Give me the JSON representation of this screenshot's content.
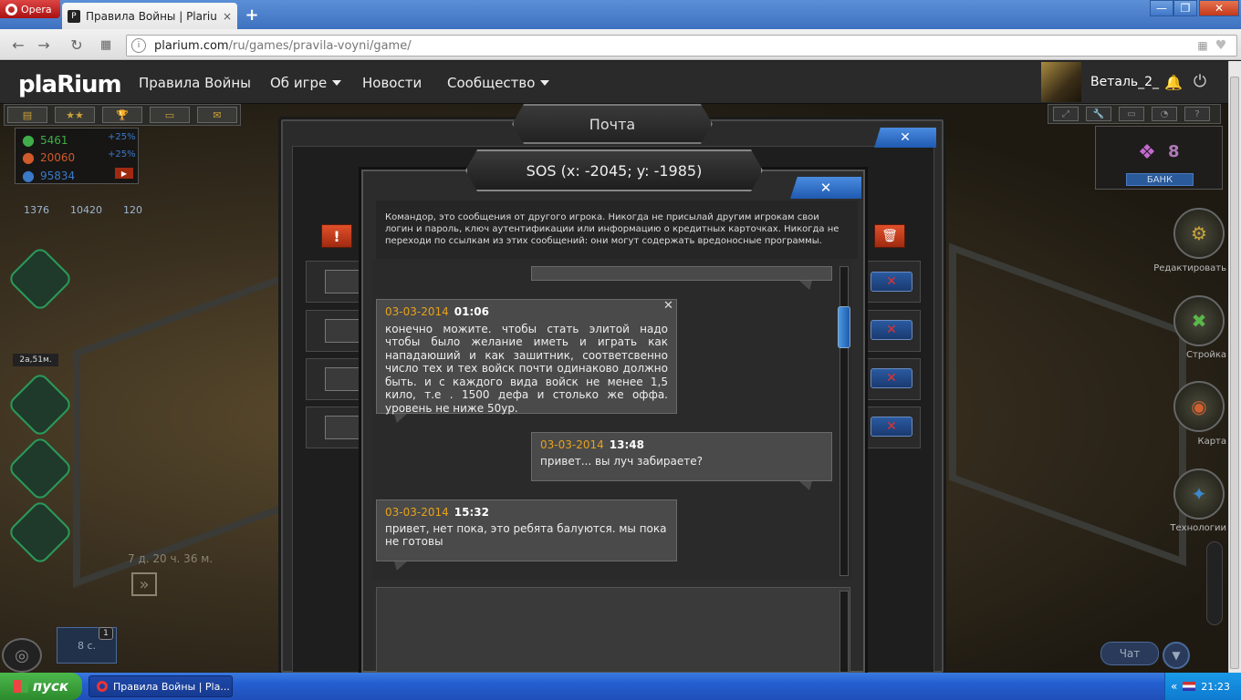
{
  "browser": {
    "menu_label": "Opera",
    "tab_title": "Правила Войны | Plarium",
    "tab_close": "×",
    "new_tab": "+",
    "url_host": "plarium.com",
    "url_path": "/ru/games/pravila-voyni/game/",
    "win_min": "—",
    "win_max": "❐",
    "win_close": "✕"
  },
  "site": {
    "logo": "plaRium",
    "nav": {
      "game": "Правила Войны",
      "about": "Об игре",
      "news": "Новости",
      "community": "Сообщество"
    },
    "username": "Веталь_2_"
  },
  "game": {
    "resources": [
      {
        "value": "5461",
        "pct": "+25%",
        "color": "#3fae4a"
      },
      {
        "value": "20060",
        "pct": "+25%",
        "color": "#d05a2a"
      },
      {
        "value": "95834",
        "pct": "",
        "color": "#3b79c9"
      }
    ],
    "stats": [
      "1376",
      "10420",
      "120"
    ],
    "power_label": "2а,51м.",
    "timer": "7 д. 20 ч. 36 м.",
    "queue_label": "8 с.",
    "queue_badge": "1",
    "bank_count": "8",
    "bank_label": "БАНК",
    "right_buttons": [
      "Редактировать",
      "Стройка",
      "Карта",
      "Технологии"
    ],
    "chat_label": "Чат"
  },
  "mail": {
    "title": "Почта",
    "close": "✕",
    "alert": "!",
    "trash": "🗑",
    "row_delete": "✕"
  },
  "sos": {
    "title": "SOS  (x: -2045; y: -1985)",
    "close": "✕",
    "warning": "Командор, это сообщения от другого игрока. Никогда не присылай другим игрокам свои логин и пароль, ключ аутентификации или информацию о кредитных карточках. Никогда не переходи по ссылкам из этих сообщений: они могут содержать вредоносные программы.",
    "messages": [
      {
        "date": "03-03-2014",
        "time": "01:06",
        "text": "конечно можите. чтобы стать элитой надо чтобы было желание иметь и играть как нападаюший и как зашитник, соответсвенно число тех и тех войск почти одинаково должно быть. и с каждого вида войск не менее 1,5 кило, т.е . 1500 дефа и столько же оффа. уровень не ниже 50ур.",
        "close": "✕"
      },
      {
        "date": "03-03-2014",
        "time": "13:48",
        "text": "привет... вы луч забираете?"
      },
      {
        "date": "03-03-2014",
        "time": "15:32",
        "text": "привет, нет пока, это ребята балуются. мы пока не готовы"
      }
    ]
  },
  "taskbar": {
    "start": "пуск",
    "item": "Правила Войны | Pla...",
    "clock": "21:23"
  }
}
